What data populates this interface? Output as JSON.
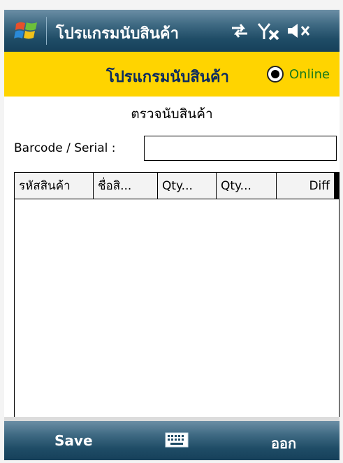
{
  "status_bar": {
    "title": "โปรแกรมนับสินค้า",
    "icons": [
      "windows-start-icon",
      "connectivity-icon",
      "signal-off-icon",
      "speaker-muted-icon"
    ]
  },
  "header": {
    "title": "โปรแกรมนับสินค้า",
    "status_label": "Online",
    "status_selected": true
  },
  "form": {
    "section_title": "ตรวจนับสินค้า",
    "barcode_label": "Barcode / Serial :",
    "barcode_value": ""
  },
  "grid": {
    "columns": [
      "รหัสสินค้า",
      "ชื่อสิ...",
      "Qty...",
      "Qty...",
      "Diff"
    ],
    "rows": []
  },
  "bottom_bar": {
    "left_softkey": "Save",
    "right_softkey": "ออก",
    "center_icon": "keyboard-icon"
  },
  "colors": {
    "header_bg": "#ffd400",
    "title_text": "#0a2a60",
    "online_text": "#1a7a1a",
    "bar_bg": "#1f4c66"
  }
}
